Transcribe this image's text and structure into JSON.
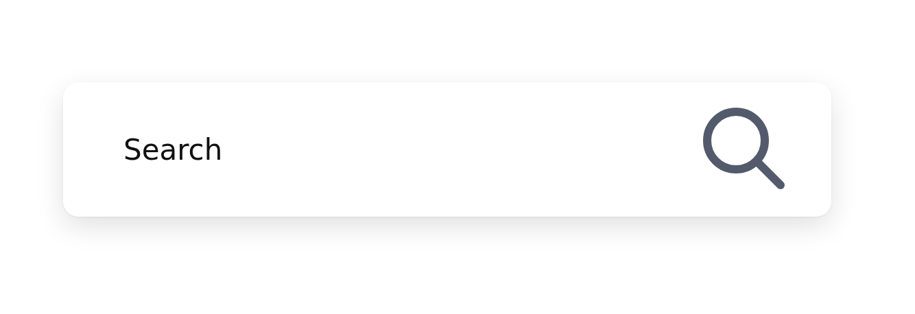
{
  "search": {
    "placeholder": "Search"
  }
}
